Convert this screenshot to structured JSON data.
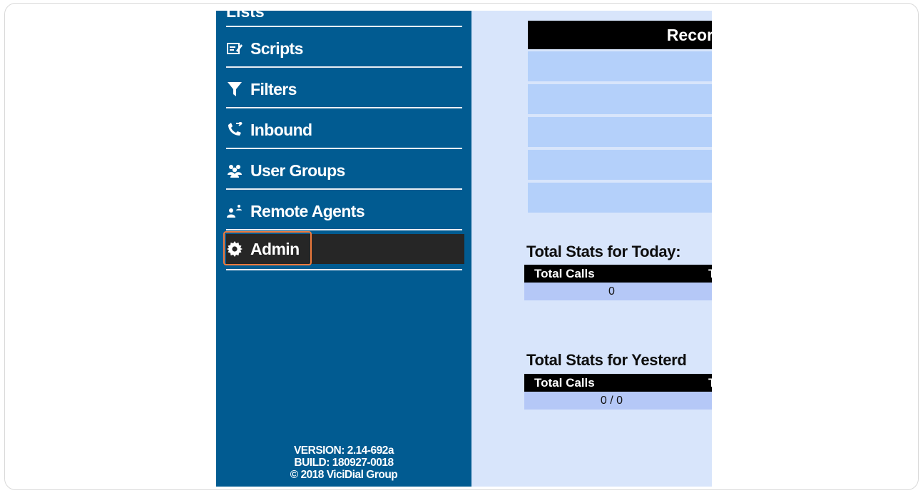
{
  "sidebar": {
    "top_fragment": "Lists",
    "items": [
      {
        "label": "Scripts",
        "icon": "edit-icon"
      },
      {
        "label": "Filters",
        "icon": "filter-icon"
      },
      {
        "label": "Inbound",
        "icon": "inbound-phone-icon"
      },
      {
        "label": "User Groups",
        "icon": "users-icon"
      },
      {
        "label": "Remote Agents",
        "icon": "remote-agents-icon"
      },
      {
        "label": "Admin",
        "icon": "gear-icon",
        "active": true
      }
    ],
    "footer": {
      "version": "VERSION: 2.14-692a",
      "build": "BUILD: 180927-0018",
      "copyright": "© 2018 ViciDial Group"
    }
  },
  "main": {
    "records_header": "Recor",
    "today": {
      "title": "Total Stats for Today:",
      "col1": "Total Calls",
      "col2": "T",
      "value": "0"
    },
    "yesterday": {
      "title": "Total Stats for Yesterd",
      "col1": "Total Calls",
      "col2": "T",
      "value": "0 / 0"
    }
  },
  "colors": {
    "sidebar": "#015b91",
    "active": "#262626",
    "highlight": "#f07a3c",
    "main_bg": "#d8e5fb"
  }
}
